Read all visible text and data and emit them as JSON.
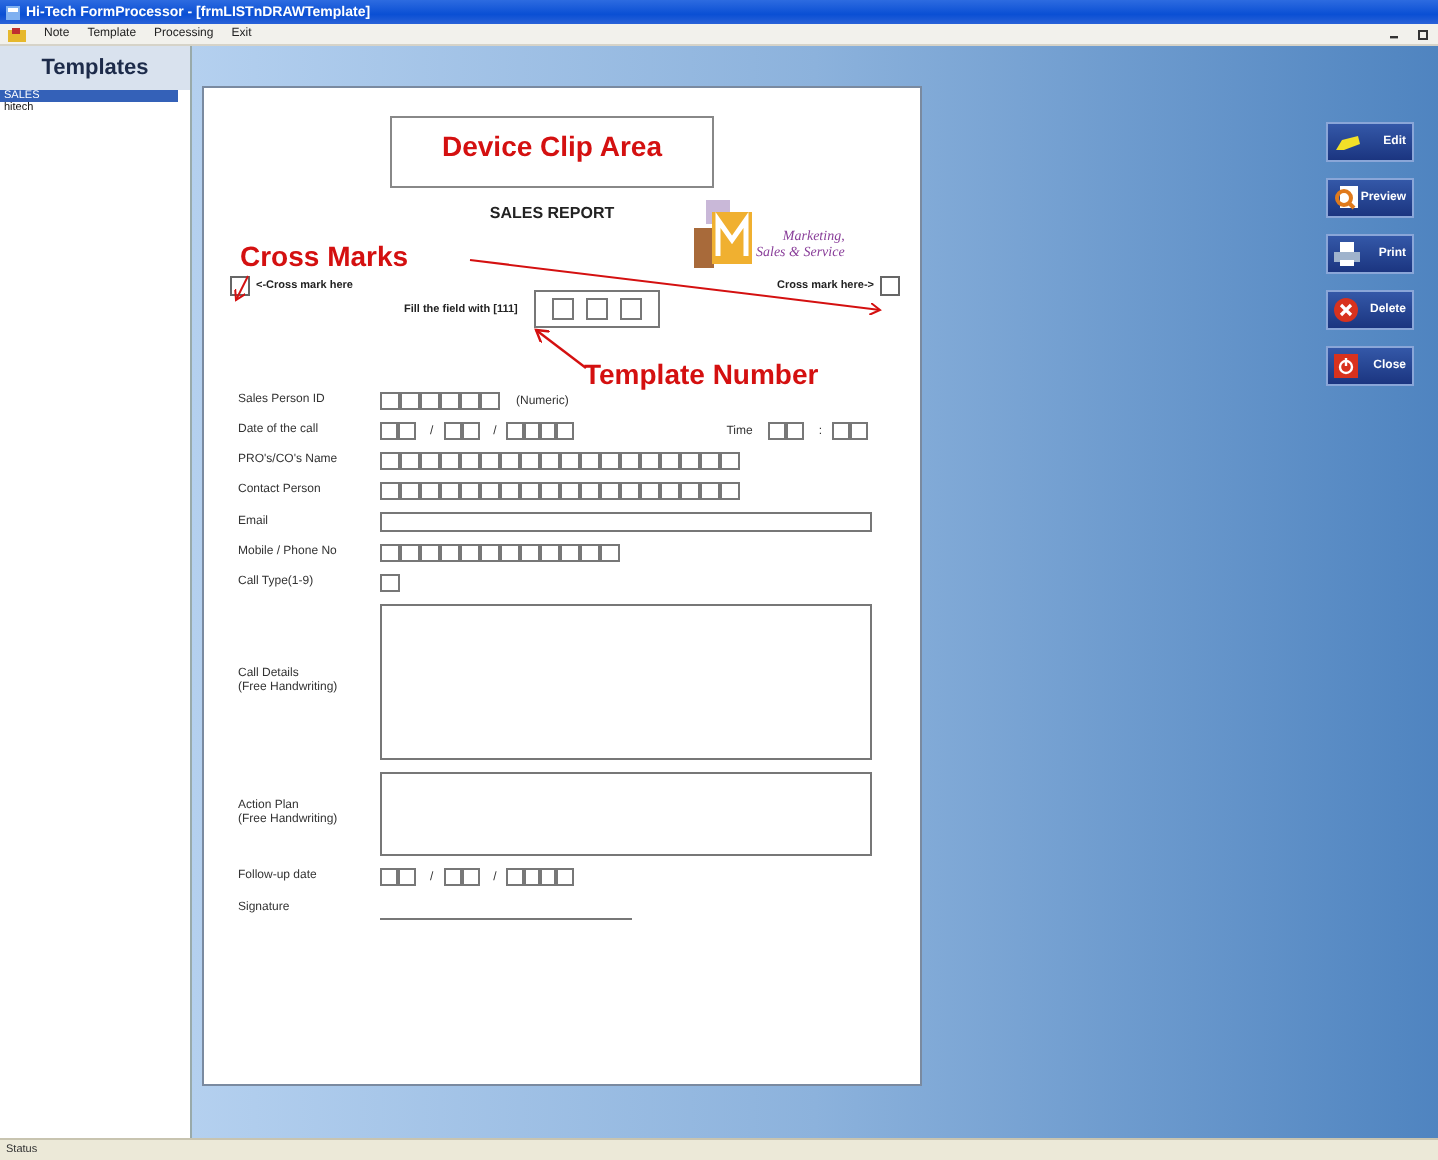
{
  "window": {
    "title": "Hi-Tech FormProcessor - [frmLISTnDRAWTemplate]"
  },
  "menu": [
    "Note",
    "Template",
    "Processing",
    "Exit"
  ],
  "sidebar": {
    "title": "Templates",
    "items": [
      {
        "label": "SALES",
        "selected": true
      },
      {
        "label": "hitech",
        "selected": false
      }
    ]
  },
  "form": {
    "clip_area": "Device Clip Area",
    "heading": "SALES REPORT",
    "logo": {
      "line1": "Marketing,",
      "line2": "Sales & Service"
    },
    "cross_left": "<-Cross mark here",
    "cross_right": "Cross mark here->",
    "fill_hint": "Fill the field with [111]",
    "fields": [
      {
        "label": "Sales Person ID",
        "kind": "boxes",
        "note": "(Numeric)"
      },
      {
        "label": "Date of the call",
        "kind": "datetime",
        "separators": [
          "/",
          "/"
        ],
        "time_label": "Time",
        "time_separator": ":"
      },
      {
        "label": "PRO's/CO's Name",
        "kind": "boxes"
      },
      {
        "label": "Contact Person",
        "kind": "boxes"
      },
      {
        "label": "Email",
        "kind": "line"
      },
      {
        "label": "Mobile / Phone No",
        "kind": "boxes"
      },
      {
        "label": "Call Type(1-9)",
        "kind": "boxes"
      },
      {
        "label": "Call Details\n(Free Handwriting)",
        "kind": "area"
      },
      {
        "label": "Action Plan\n(Free Handwriting)",
        "kind": "area"
      },
      {
        "label": "Follow-up date",
        "kind": "date",
        "separators": [
          "/",
          "/"
        ]
      },
      {
        "label": "Signature",
        "kind": "signature"
      }
    ]
  },
  "annotations": [
    {
      "text": "Cross Marks"
    },
    {
      "text": "Template Number"
    }
  ],
  "buttons": [
    {
      "label": "Edit",
      "kind": "edit"
    },
    {
      "label": "Preview",
      "kind": "preview"
    },
    {
      "label": "Print",
      "kind": "print"
    },
    {
      "label": "Delete",
      "kind": "delete"
    },
    {
      "label": "Close",
      "kind": "close"
    }
  ],
  "status_bar": "Status"
}
